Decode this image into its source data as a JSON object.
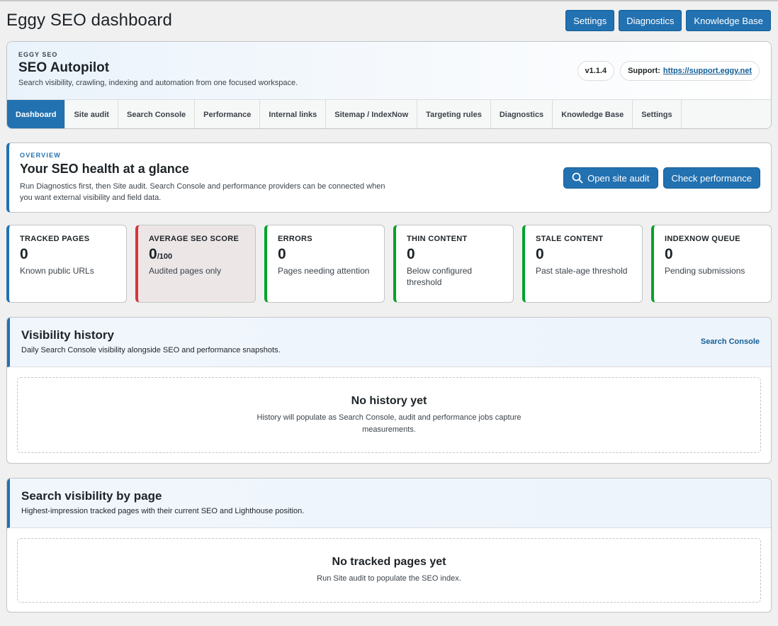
{
  "page": {
    "title": "Eggy SEO dashboard",
    "actions": [
      "Settings",
      "Diagnostics",
      "Knowledge Base"
    ]
  },
  "header": {
    "eyebrow": "EGGY SEO",
    "title": "SEO Autopilot",
    "subtitle": "Search visibility, crawling, indexing and automation from one focused workspace.",
    "version": "v1.1.4",
    "support_label": "Support:",
    "support_link": "https://support.eggy.net"
  },
  "tabs": [
    {
      "label": "Dashboard",
      "active": true
    },
    {
      "label": "Site audit"
    },
    {
      "label": "Search Console"
    },
    {
      "label": "Performance"
    },
    {
      "label": "Internal links"
    },
    {
      "label": "Sitemap / IndexNow"
    },
    {
      "label": "Targeting rules"
    },
    {
      "label": "Diagnostics"
    },
    {
      "label": "Knowledge Base"
    },
    {
      "label": "Settings"
    }
  ],
  "overview": {
    "eyebrow": "OVERVIEW",
    "title": "Your SEO health at a glance",
    "text": "Run Diagnostics first, then Site audit. Search Console and performance providers can be connected when you want external visibility and field data.",
    "open_audit": "Open site audit",
    "check_performance": "Check performance"
  },
  "stats": [
    {
      "label": "TRACKED PAGES",
      "value": "0",
      "suffix": "",
      "desc": "Known public URLs",
      "accent": "#2271b1"
    },
    {
      "label": "AVERAGE SEO SCORE",
      "value": "0",
      "suffix": "/100",
      "desc": "Audited pages only",
      "accent": "#d63638"
    },
    {
      "label": "ERRORS",
      "value": "0",
      "suffix": "",
      "desc": "Pages needing attention",
      "accent": "#00a32a"
    },
    {
      "label": "THIN CONTENT",
      "value": "0",
      "suffix": "",
      "desc": "Below configured threshold",
      "accent": "#00a32a"
    },
    {
      "label": "STALE CONTENT",
      "value": "0",
      "suffix": "",
      "desc": "Past stale-age threshold",
      "accent": "#00a32a"
    },
    {
      "label": "INDEXNOW QUEUE",
      "value": "0",
      "suffix": "",
      "desc": "Pending submissions",
      "accent": "#00a32a"
    }
  ],
  "visibility_history": {
    "title": "Visibility history",
    "subtitle": "Daily Search Console visibility alongside SEO and performance snapshots.",
    "link": "Search Console",
    "empty_title": "No history yet",
    "empty_text": "History will populate as Search Console, audit and performance jobs capture measurements."
  },
  "search_visibility": {
    "title": "Search visibility by page",
    "subtitle": "Highest-impression tracked pages with their current SEO and Lighthouse position.",
    "empty_title": "No tracked pages yet",
    "empty_text": "Run Site audit to populate the SEO index."
  },
  "colors": {
    "accent": "#2271b1",
    "error": "#d63638",
    "success": "#00a32a"
  }
}
